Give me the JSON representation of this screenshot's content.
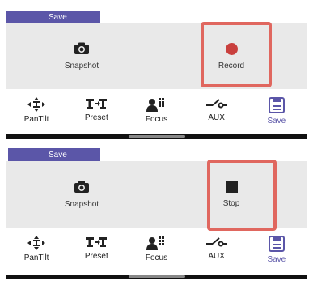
{
  "panels": [
    {
      "save_tab": "Save",
      "left_action": {
        "label": "Snapshot",
        "icon": "camera-icon"
      },
      "right_action": {
        "label": "Record",
        "icon": "record-icon"
      },
      "highlight_color": "#e0675f",
      "toolbar": [
        {
          "label": "PanTilt",
          "icon": "pan-tilt-icon"
        },
        {
          "label": "Preset",
          "icon": "preset-icon"
        },
        {
          "label": "Focus",
          "icon": "focus-icon"
        },
        {
          "label": "AUX",
          "icon": "aux-switch-icon"
        },
        {
          "label": "Save",
          "icon": "save-icon",
          "active": true
        }
      ]
    },
    {
      "save_tab": "Save",
      "left_action": {
        "label": "Snapshot",
        "icon": "camera-icon"
      },
      "right_action": {
        "label": "Stop",
        "icon": "stop-icon"
      },
      "highlight_color": "#e0675f",
      "toolbar": [
        {
          "label": "PanTilt",
          "icon": "pan-tilt-icon"
        },
        {
          "label": "Preset",
          "icon": "preset-icon"
        },
        {
          "label": "Focus",
          "icon": "focus-icon"
        },
        {
          "label": "AUX",
          "icon": "aux-switch-icon"
        },
        {
          "label": "Save",
          "icon": "save-icon",
          "active": true
        }
      ]
    }
  ],
  "colors": {
    "accent": "#5b56a8",
    "record": "#c9403e",
    "highlight": "#e0675f",
    "panel_bg": "#e9e9e9"
  }
}
